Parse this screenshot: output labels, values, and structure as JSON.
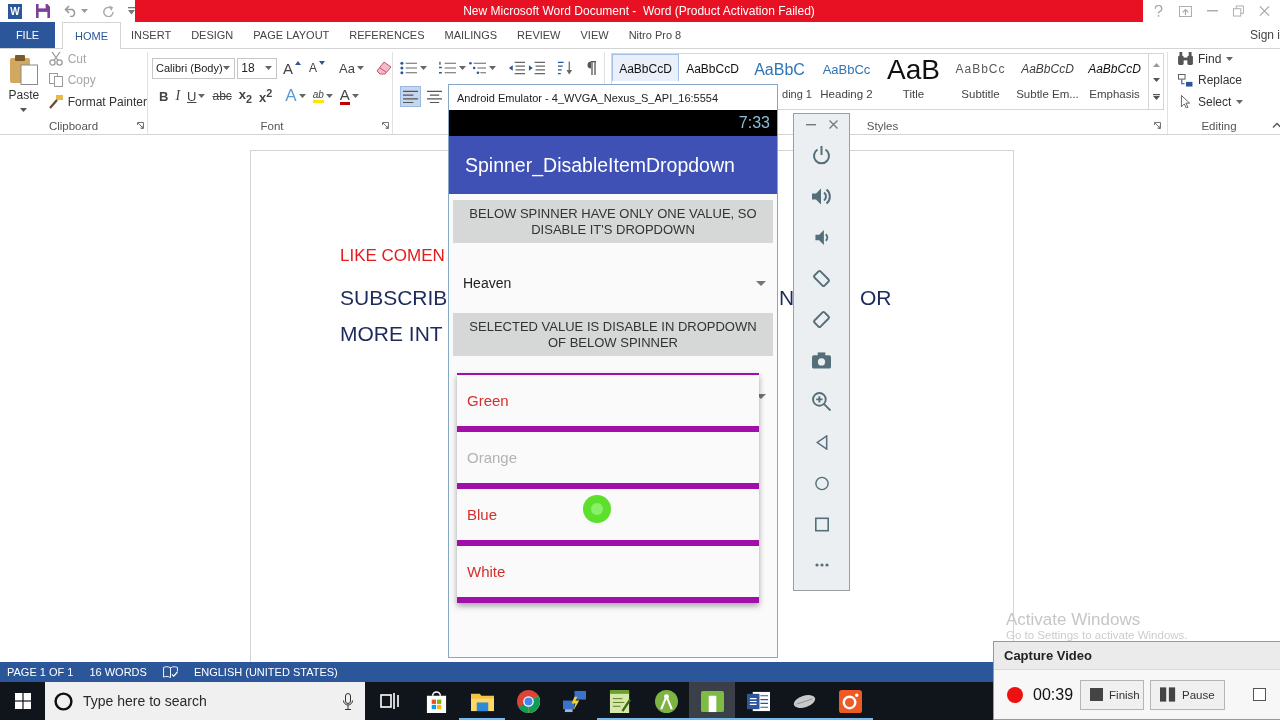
{
  "word": {
    "logo": "W",
    "title": "New Microsoft Word Document -  Word (Product Activation Failed)",
    "tabs": [
      {
        "label": "FILE",
        "kind": "file",
        "selected": false
      },
      {
        "label": "HOME",
        "kind": "tab",
        "selected": true
      },
      {
        "label": "INSERT",
        "kind": "tab",
        "selected": false
      },
      {
        "label": "DESIGN",
        "kind": "tab",
        "selected": false
      },
      {
        "label": "PAGE LAYOUT",
        "kind": "tab",
        "selected": false
      },
      {
        "label": "REFERENCES",
        "kind": "tab",
        "selected": false
      },
      {
        "label": "MAILINGS",
        "kind": "tab",
        "selected": false
      },
      {
        "label": "REVIEW",
        "kind": "tab",
        "selected": false
      },
      {
        "label": "VIEW",
        "kind": "tab",
        "selected": false
      },
      {
        "label": "Nitro Pro 8",
        "kind": "tab",
        "selected": false
      }
    ],
    "account": "Sign i",
    "clipboard": {
      "label": "Clipboard",
      "paste": "Paste",
      "tools": [
        {
          "label": "Cut",
          "kind": "cut",
          "disabled": true
        },
        {
          "label": "Copy",
          "kind": "copy",
          "disabled": true
        },
        {
          "label": "Format Painter",
          "kind": "painter",
          "disabled": false
        }
      ]
    },
    "font": {
      "label": "Font",
      "font_name": "Calibri (Body)",
      "font_size": "18",
      "row_1": [
        {
          "label": "A",
          "kind": "grow"
        },
        {
          "label": "A",
          "kind": "shrink"
        },
        {
          "label": "Aa",
          "kind": "case"
        },
        {
          "kind": "clear"
        }
      ],
      "row_2": [
        {
          "label": "B",
          "kind": "bold"
        },
        {
          "label": "I",
          "kind": "italic"
        },
        {
          "label": "U",
          "kind": "underline"
        },
        {
          "label": "abc",
          "kind": "strike"
        },
        {
          "label": "x$_{2}$",
          "kind": "subscript"
        },
        {
          "label": "x$^{2}$",
          "kind": "superscript"
        },
        {
          "label": "A",
          "kind": "effects"
        },
        {
          "label": "ab",
          "kind": "highlight"
        },
        {
          "label": "A",
          "kind": "color"
        }
      ]
    },
    "paragraph": {
      "align": [
        {
          "kind": "left",
          "selected": true
        },
        {
          "kind": "center",
          "selected": false
        }
      ]
    },
    "styles": {
      "label": "Styles",
      "items": [
        {
          "preview": "AaBbCcD",
          "kind": "normal",
          "selected": true
        },
        {
          "preview": "AaBbCcD",
          "kind": "plain",
          "selected": false
        },
        {
          "preview": "AaBbC",
          "name": "ding 1",
          "kind": "heading1",
          "selected": false
        },
        {
          "preview": "AaBbCc",
          "name": "Heading 2",
          "kind": "heading2",
          "selected": false
        },
        {
          "preview": "AaB",
          "name": "Title",
          "kind": "title",
          "selected": false
        },
        {
          "preview": "AaBbCc",
          "name": "Subtitle",
          "kind": "subtitle",
          "selected": false
        },
        {
          "preview": "AaBbCcD",
          "name": "Subtle Em...",
          "kind": "subtle",
          "selected": false
        },
        {
          "preview": "AaBbCcD",
          "name": "Emphasis",
          "kind": "emphasis",
          "selected": false
        }
      ]
    },
    "editing": {
      "label": "Editing",
      "tools": [
        {
          "label": "Find",
          "kind": "find"
        },
        {
          "label": "Replace",
          "kind": "replace"
        },
        {
          "label": "Select",
          "kind": "select"
        }
      ]
    },
    "document": {
      "lines": [
        {
          "kind": "comment",
          "parts": [
            "LIKE COMEN"
          ]
        },
        {
          "kind": "body",
          "parts": [
            "SUBSCRIB",
            "N",
            "OR"
          ]
        },
        {
          "kind": "body",
          "parts": [
            "MORE INT"
          ]
        }
      ]
    },
    "status_bar": {
      "items": [
        {
          "kind": "text",
          "text": "PAGE 1 OF 1"
        },
        {
          "kind": "text",
          "text": "16 WORDS"
        },
        {
          "kind": "proofing"
        },
        {
          "kind": "text",
          "text": "ENGLISH (UNITED STATES)"
        }
      ]
    }
  },
  "emulator": {
    "title": "Android Emulator - 4_WVGA_Nexus_S_API_16:5554",
    "clock": "7:33",
    "app_title": "Spinner_DisableItemDropdown",
    "content": [
      {
        "kind": "note",
        "text": "BELOW SPINNER HAVE ONLY ONE VALUE, SO DISABLE IT'S DROPDOWN"
      },
      {
        "kind": "spinner",
        "value": "Heaven"
      },
      {
        "kind": "note",
        "text": "SELECTED VALUE IS DISABLE IN DROPDOWN OF BELOW SPINNER"
      },
      {
        "kind": "spinner"
      }
    ],
    "dropdown": {
      "items": [
        {
          "label": "Green",
          "disabled": false
        },
        {
          "label": "Orange",
          "disabled": true
        },
        {
          "label": "Blue",
          "disabled": false
        },
        {
          "label": "White",
          "disabled": false
        }
      ]
    }
  },
  "taskbar": {
    "search_placeholder": "Type here to search",
    "apps": [
      {
        "kind": "task-view",
        "running": false,
        "selected": false
      },
      {
        "kind": "store",
        "running": false,
        "selected": false
      },
      {
        "kind": "folder",
        "running": true,
        "selected": false
      },
      {
        "kind": "browser",
        "running": false,
        "selected": false
      },
      {
        "kind": "network",
        "running": false,
        "selected": false
      },
      {
        "kind": "notepad",
        "running": true,
        "selected": false
      },
      {
        "kind": "android",
        "running": true,
        "selected": false
      },
      {
        "kind": "window-app",
        "running": true,
        "selected": true
      },
      {
        "kind": "word",
        "running": true,
        "selected": false
      },
      {
        "kind": "mouse",
        "running": true,
        "selected": false
      },
      {
        "kind": "camera",
        "running": true,
        "selected": false
      }
    ]
  },
  "capture": {
    "title": "Capture Video",
    "recording": true,
    "elapsed": "00:39",
    "buttons": [
      {
        "label": "Finish",
        "kind": "stop"
      },
      {
        "label": "Pause",
        "kind": "pause"
      }
    ],
    "checkbox": {
      "checked": false
    }
  },
  "activation": {
    "title": "Activate Windows",
    "message": "Go to Settings to activate Windows."
  }
}
